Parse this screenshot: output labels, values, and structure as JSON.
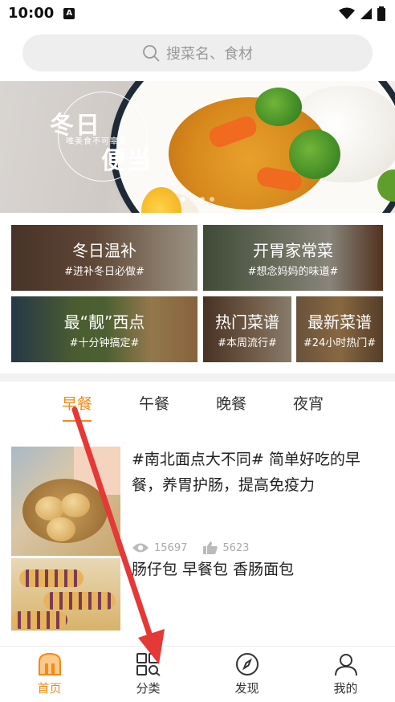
{
  "status_bar": {
    "time": "10:00",
    "badge": "A"
  },
  "search": {
    "placeholder": "搜菜名、食材"
  },
  "banner": {
    "title_1": "冬日",
    "subtitle": "唯美食不可辜负",
    "title_2": "便当"
  },
  "categories": [
    {
      "title": "冬日温补",
      "subtitle": "#进补冬日必做#"
    },
    {
      "title": "开胃家常菜",
      "subtitle": "#想念妈妈的味道#"
    },
    {
      "title": "最“靓”西点",
      "subtitle": "#十分钟搞定#"
    },
    {
      "title": "热门菜谱",
      "subtitle": "#本周流行#"
    },
    {
      "title": "最新菜谱",
      "subtitle": "#24小时热门#"
    }
  ],
  "tabs": [
    {
      "label": "早餐",
      "active": true
    },
    {
      "label": "午餐",
      "active": false
    },
    {
      "label": "晚餐",
      "active": false
    },
    {
      "label": "夜宵",
      "active": false
    }
  ],
  "recipes": [
    {
      "title": "#南北面点大不同# 简单好吃的早餐，养胃护肠，提高免疫力",
      "views": "15697",
      "likes": "5623"
    },
    {
      "title": "肠仔包 早餐包 香肠面包"
    }
  ],
  "bottom_nav": [
    {
      "label": "首页",
      "icon": "home-icon",
      "active": true
    },
    {
      "label": "分类",
      "icon": "category-grid-icon",
      "active": false
    },
    {
      "label": "发现",
      "icon": "compass-icon",
      "active": false
    },
    {
      "label": "我的",
      "icon": "user-icon",
      "active": false
    }
  ],
  "colors": {
    "accent": "#f08b1a",
    "arrow": "#e53935"
  }
}
